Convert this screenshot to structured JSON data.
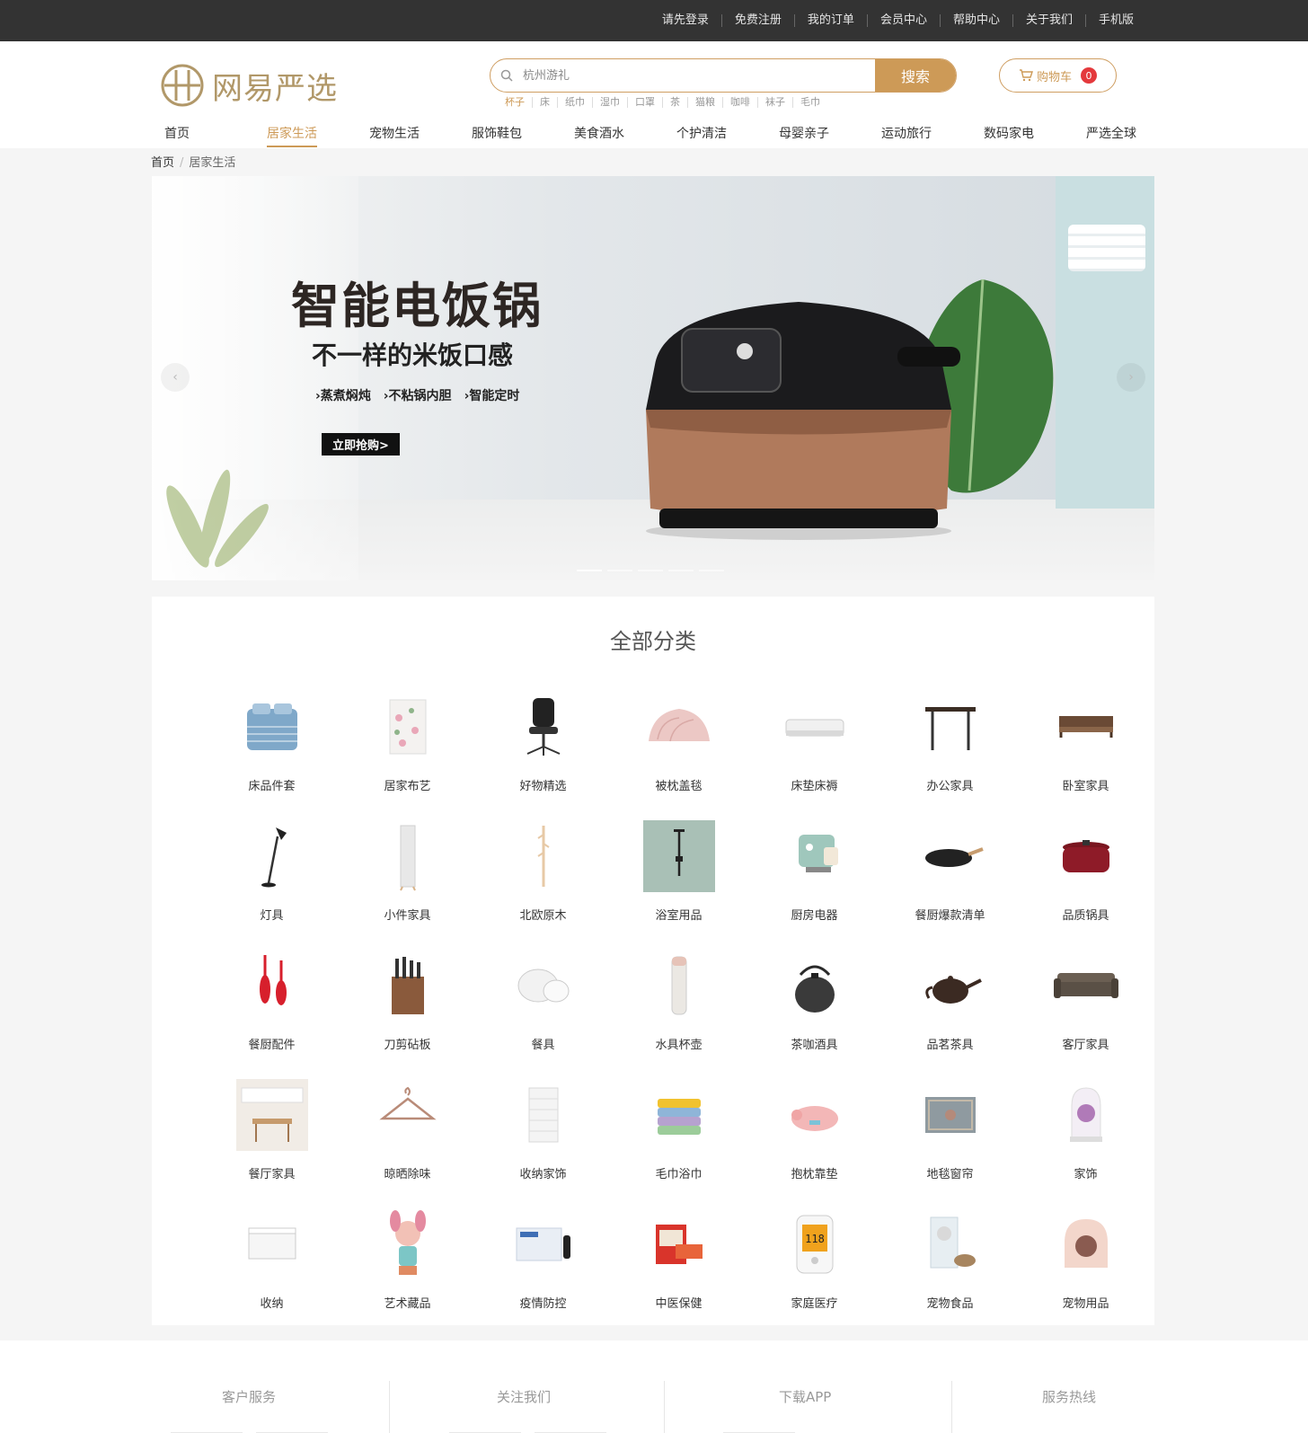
{
  "topbar": {
    "links": [
      "请先登录",
      "免费注册",
      "我的订单",
      "会员中心",
      "帮助中心",
      "关于我们",
      "手机版"
    ]
  },
  "header": {
    "logo_text": "网易严选",
    "search_placeholder": "杭州游礼",
    "search_button": "搜索",
    "hot_words": [
      "杯子",
      "床",
      "纸巾",
      "湿巾",
      "口罩",
      "茶",
      "猫粮",
      "咖啡",
      "袜子",
      "毛巾"
    ],
    "cart_label": "购物车",
    "cart_count": "0"
  },
  "nav": {
    "items": [
      "首页",
      "居家生活",
      "宠物生活",
      "服饰鞋包",
      "美食酒水",
      "个护清洁",
      "母婴亲子",
      "运动旅行",
      "数码家电",
      "严选全球"
    ],
    "active_index": 1
  },
  "breadcrumb": {
    "home": "首页",
    "separator": "/",
    "current": "居家生活"
  },
  "banner": {
    "title": "智能电饭锅",
    "subtitle": "不一样的米饭口感",
    "features": [
      "›蒸煮焖炖",
      "›不粘锅内胆",
      "›智能定时"
    ],
    "cta": "立即抢购>",
    "prev_arrow": "‹",
    "next_arrow": "›",
    "slide_count": 5,
    "active_slide": 0
  },
  "categories": {
    "title": "全部分类",
    "items": [
      {
        "label": "床品件套",
        "icon": "bedding"
      },
      {
        "label": "居家布艺",
        "icon": "fabric"
      },
      {
        "label": "好物精选",
        "icon": "office-chair"
      },
      {
        "label": "被枕盖毯",
        "icon": "quilt"
      },
      {
        "label": "床垫床褥",
        "icon": "mattress"
      },
      {
        "label": "办公家具",
        "icon": "desk"
      },
      {
        "label": "卧室家具",
        "icon": "bed-frame"
      },
      {
        "label": "灯具",
        "icon": "floor-lamp"
      },
      {
        "label": "小件家具",
        "icon": "mirror"
      },
      {
        "label": "北欧原木",
        "icon": "coat-rack"
      },
      {
        "label": "浴室用品",
        "icon": "shower"
      },
      {
        "label": "厨房电器",
        "icon": "coffee-machine"
      },
      {
        "label": "餐厨爆款清单",
        "icon": "wok"
      },
      {
        "label": "品质锅具",
        "icon": "dutch-oven"
      },
      {
        "label": "餐厨配件",
        "icon": "spatula"
      },
      {
        "label": "刀剪砧板",
        "icon": "knife-block"
      },
      {
        "label": "餐具",
        "icon": "dishes"
      },
      {
        "label": "水具杯壶",
        "icon": "thermos"
      },
      {
        "label": "茶咖酒具",
        "icon": "kettle"
      },
      {
        "label": "品茗茶具",
        "icon": "teapot"
      },
      {
        "label": "客厅家具",
        "icon": "sofa"
      },
      {
        "label": "餐厅家具",
        "icon": "dining-room"
      },
      {
        "label": "晾晒除味",
        "icon": "hanger"
      },
      {
        "label": "收纳家饰",
        "icon": "drawer-cabinet"
      },
      {
        "label": "毛巾浴巾",
        "icon": "towels"
      },
      {
        "label": "抱枕靠垫",
        "icon": "pig-pillow"
      },
      {
        "label": "地毯窗帘",
        "icon": "carpet"
      },
      {
        "label": "家饰",
        "icon": "flower-dome"
      },
      {
        "label": "收纳",
        "icon": "storage-box"
      },
      {
        "label": "艺术藏品",
        "icon": "figurine"
      },
      {
        "label": "疫情防控",
        "icon": "test-kit"
      },
      {
        "label": "中医保健",
        "icon": "herbal-box"
      },
      {
        "label": "家庭医疗",
        "icon": "blood-pressure-monitor"
      },
      {
        "label": "宠物食品",
        "icon": "pet-food"
      },
      {
        "label": "宠物用品",
        "icon": "cat-litter-box"
      }
    ]
  },
  "footer": {
    "columns": [
      "客户服务",
      "关注我们",
      "下载APP",
      "服务热线"
    ]
  }
}
